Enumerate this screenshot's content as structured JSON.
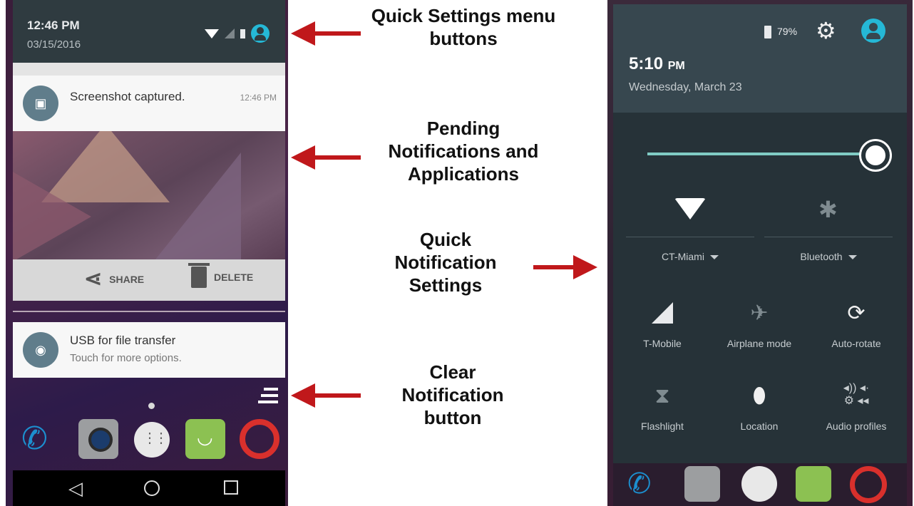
{
  "left_phone": {
    "status_bar": {
      "time": "12:46 PM",
      "date": "03/15/2016",
      "icons": [
        "wifi-icon",
        "signal-icon",
        "battery-icon",
        "user-avatar-icon"
      ]
    },
    "screenshot_notification": {
      "title": "Screenshot captured.",
      "time": "12:46 PM",
      "icon": "image-icon"
    },
    "actions": {
      "share_label": "SHARE",
      "delete_label": "DELETE"
    },
    "usb_notification": {
      "title": "USB for file transfer",
      "subtitle": "Touch for more options.",
      "icon": "android-icon"
    },
    "dock_apps": [
      "phone-icon",
      "camera-icon",
      "app-drawer-icon",
      "messaging-icon",
      "opera-icon"
    ],
    "nav": [
      "back-icon",
      "home-icon",
      "recents-icon"
    ]
  },
  "callouts": {
    "quick_settings": "Quick Settings menu buttons",
    "pending": "Pending Notifications and Applications",
    "quick_notification": "Quick Notification Settings",
    "clear": "Clear Notification button"
  },
  "right_phone": {
    "header": {
      "battery": "79%",
      "time": "5:10",
      "time_suffix": "PM",
      "date": "Wednesday, March 23"
    },
    "brightness": {
      "level": 0.97
    },
    "big_tiles": [
      {
        "label": "CT-Miami",
        "icon": "wifi-icon"
      },
      {
        "label": "Bluetooth",
        "icon": "bluetooth-off-icon"
      }
    ],
    "tiles": [
      {
        "label": "T-Mobile",
        "icon": "signal-icon"
      },
      {
        "label": "Airplane mode",
        "icon": "airplane-icon"
      },
      {
        "label": "Auto-rotate",
        "icon": "auto-rotate-icon"
      },
      {
        "label": "Flashlight",
        "icon": "flashlight-icon"
      },
      {
        "label": "Location",
        "icon": "location-icon"
      },
      {
        "label": "Audio profiles",
        "icon": "audio-profiles-icon"
      }
    ]
  },
  "colors": {
    "accent": "#25b8d6",
    "arrow": "#c0181b",
    "brightness_track": "#80cbc4"
  }
}
